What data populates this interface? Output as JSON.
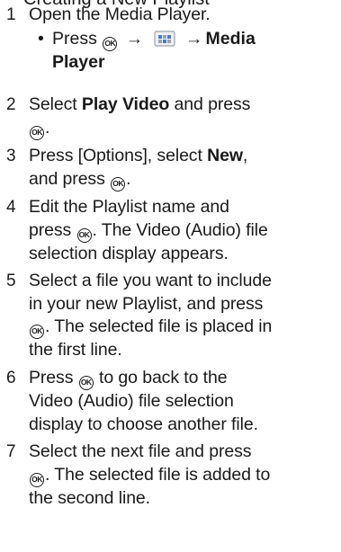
{
  "header_fragment": "Creating a New Playlist",
  "steps": [
    {
      "num": "1",
      "pre": "Open the Media Player.",
      "bold": "",
      "post": ""
    },
    {
      "num": "2",
      "pre": "Select ",
      "bold": "Play Video",
      "post": " and press"
    },
    {
      "num": "3",
      "pre": "Press [Options], select ",
      "bold": "New",
      "post": ","
    },
    {
      "num": "4",
      "pre": "Edit the Playlist name and",
      "bold": "",
      "post": ""
    },
    {
      "num": "5",
      "pre": "Select a file you want to include",
      "bold": "",
      "post": ""
    },
    {
      "num": "6",
      "pre": "Press",
      "bold": "",
      "post": " to go back to the"
    },
    {
      "num": "7",
      "pre": "Select the next file and press",
      "bold": "",
      "post": ""
    }
  ],
  "step1_sub": {
    "press": "Press",
    "target": "Media",
    "target2": "Player"
  },
  "ok_label": "OK",
  "lines": {
    "s2_l2": ".",
    "s3_l2": "and press",
    "s3_l2_end": ".",
    "s4_l2_a": "press",
    "s4_l2_b": ". The Video (Audio) file",
    "s4_l3": "selection display appears.",
    "s5_l2": "in your new Playlist, and press",
    "s5_l3_b": ". The selected file is placed in",
    "s5_l4": "the first line.",
    "s6_l2": "Video (Audio) file selection",
    "s6_l3": "display to choose another file.",
    "s7_l2_b": ". The selected file is added to",
    "s7_l3": "the second line."
  },
  "colors": {
    "text": "#1a1a1a",
    "icon_blue": "#4a7bbf",
    "icon_grey": "#9aa3ad"
  }
}
